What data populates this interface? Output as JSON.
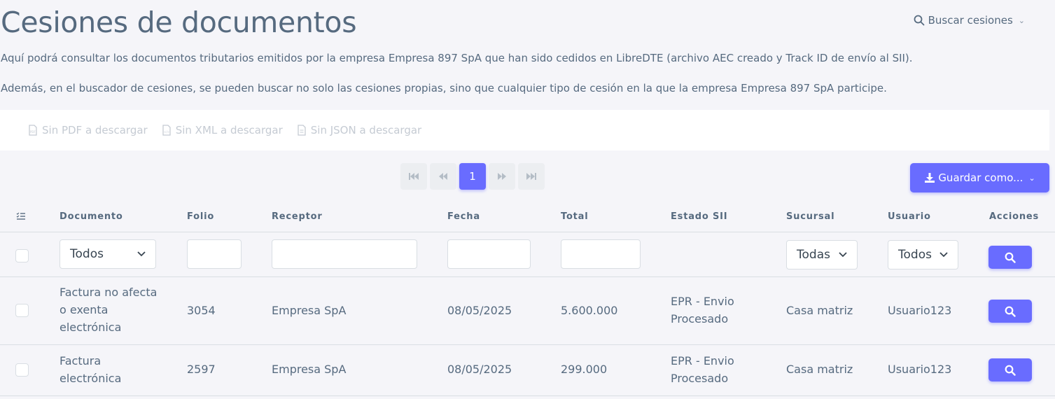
{
  "header": {
    "title": "Cesiones de documentos",
    "search_label": "Buscar cesiones"
  },
  "description": {
    "line1": "Aquí podrá consultar los documentos tributarios emitidos por la empresa Empresa 897 SpA que han sido cedidos en LibreDTE (archivo AEC creado y Track ID de envío al SII).",
    "line2": "Además, en el buscador de cesiones, se pueden buscar no solo las cesiones propias, sino que cualquier tipo de cesión en la que la empresa Empresa 897 SpA participe."
  },
  "downloads": {
    "pdf": "Sin PDF a descargar",
    "xml": "Sin XML a descargar",
    "json": "Sin JSON a descargar"
  },
  "pagination": {
    "current_page": "1"
  },
  "toolbar": {
    "save_label": "Guardar como..."
  },
  "table": {
    "columns": {
      "documento": "Documento",
      "folio": "Folio",
      "receptor": "Receptor",
      "fecha": "Fecha",
      "total": "Total",
      "estado": "Estado SII",
      "sucursal": "Sucursal",
      "usuario": "Usuario",
      "acciones": "Acciones"
    },
    "filters": {
      "documento": "Todos",
      "sucursal": "Todas",
      "usuario": "Todos"
    },
    "rows": [
      {
        "documento_l1": "Factura no afecta",
        "documento_l2": "o exenta",
        "documento_l3": "electrónica",
        "folio": "3054",
        "receptor": "Empresa SpA",
        "fecha": "08/05/2025",
        "total": "5.600.000",
        "estado_l1": "EPR - Envio",
        "estado_l2": "Procesado",
        "sucursal": "Casa matriz",
        "usuario": "Usuario123"
      },
      {
        "documento_l1": "Factura",
        "documento_l2": "electrónica",
        "folio": "2597",
        "receptor": "Empresa SpA",
        "fecha": "08/05/2025",
        "total": "299.000",
        "estado_l1": "EPR - Envio",
        "estado_l2": "Procesado",
        "sucursal": "Casa matriz",
        "usuario": "Usuario123"
      }
    ]
  },
  "colors": {
    "accent": "#696cff",
    "text": "#566a7f",
    "background": "#f5f5f9",
    "disabled": "#c5cbd3"
  }
}
